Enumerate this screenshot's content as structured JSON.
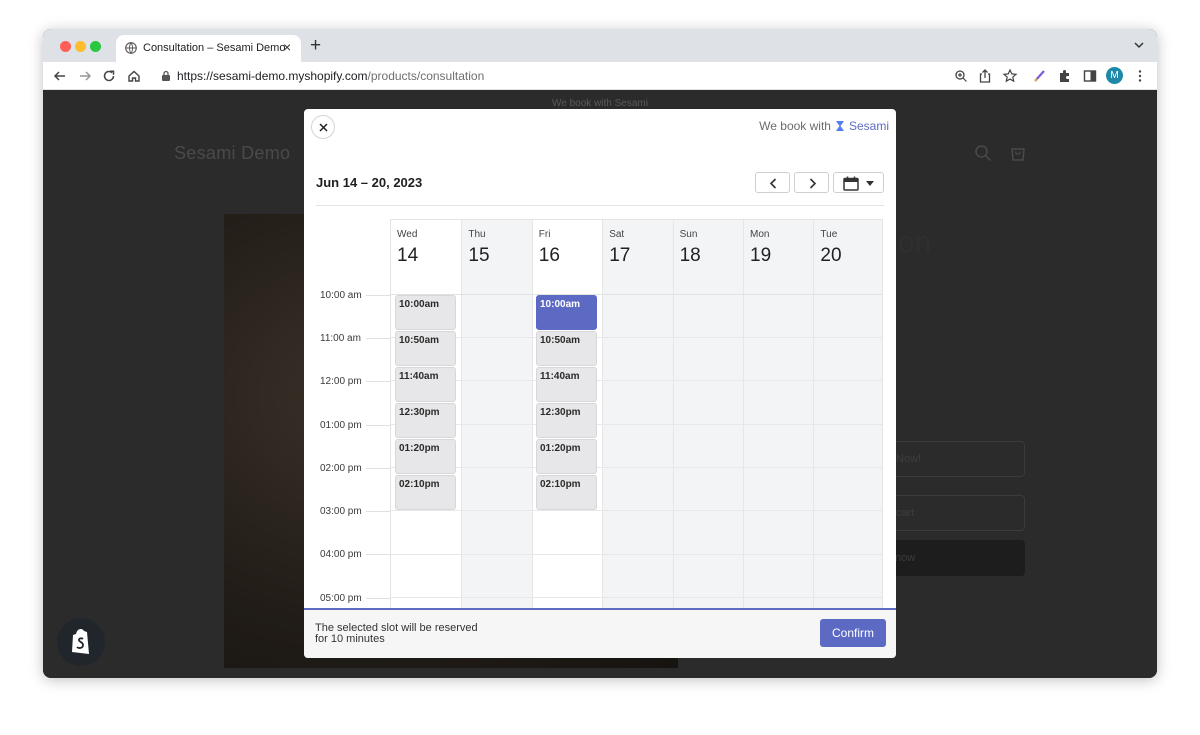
{
  "browser": {
    "tab_title": "Consultation – Sesami Demo",
    "tab_close": "×",
    "new_tab": "+",
    "url_host": "https://sesami-demo.myshopify.com",
    "url_path": "/products/consultation",
    "avatar_letter": "M"
  },
  "store": {
    "announcement": "We book with Sesami",
    "name": "Sesami Demo",
    "product_title_fragment": "on",
    "button_primary_fragment": "Now!",
    "button_cart_fragment": "cart",
    "button_buy_fragment": "now"
  },
  "modal": {
    "powered_by_prefix": "We book with",
    "powered_by_brand": "Sesami",
    "date_range": "Jun 14 – 20, 2023",
    "days": [
      {
        "dow": "Wed",
        "num": "14",
        "available": true
      },
      {
        "dow": "Thu",
        "num": "15",
        "available": false
      },
      {
        "dow": "Fri",
        "num": "16",
        "available": true
      },
      {
        "dow": "Sat",
        "num": "17",
        "available": false
      },
      {
        "dow": "Sun",
        "num": "18",
        "available": false
      },
      {
        "dow": "Mon",
        "num": "19",
        "available": false
      },
      {
        "dow": "Tue",
        "num": "20",
        "available": false
      }
    ],
    "time_labels": [
      "10:00 am",
      "11:00 am",
      "12:00 pm",
      "01:00 pm",
      "02:00 pm",
      "03:00 pm",
      "04:00 pm",
      "05:00 pm"
    ],
    "slots": {
      "wed": [
        "10:00am",
        "10:50am",
        "11:40am",
        "12:30pm",
        "01:20pm",
        "02:10pm"
      ],
      "fri": [
        "10:00am",
        "10:50am",
        "11:40am",
        "12:30pm",
        "01:20pm",
        "02:10pm"
      ]
    },
    "selected_slot": "Fri 10:00am",
    "footer_note_line1": "The selected slot will be reserved",
    "footer_note_line2": "for 10 minutes",
    "confirm_label": "Confirm"
  },
  "colors": {
    "accent": "#5c6ac4",
    "disabled_column": "#f3f4f6",
    "slot_bg": "#e7e7e9"
  },
  "icons": [
    "globe-icon",
    "back-icon",
    "forward-icon",
    "reload-icon",
    "home-icon",
    "lock-icon",
    "zoom-icon",
    "share-icon",
    "star-icon",
    "pen-icon",
    "puzzle-icon",
    "sidepanel-icon",
    "kebab-icon",
    "close-icon",
    "hourglass-icon",
    "chevron-left-icon",
    "chevron-right-icon",
    "calendar-icon",
    "shopify-icon"
  ]
}
